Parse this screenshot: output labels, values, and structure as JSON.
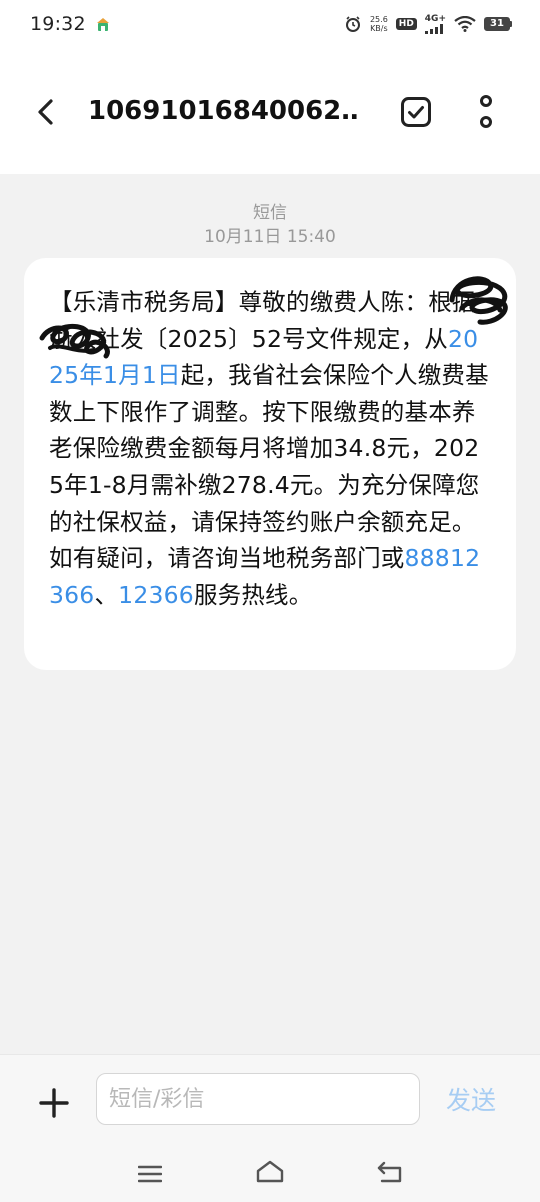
{
  "status_bar": {
    "time": "19:32",
    "net_speed_value": "25.6",
    "net_speed_unit": "KB/s",
    "hd": "HD",
    "network": "4G+",
    "battery": "31"
  },
  "header": {
    "title": "10691016840062…"
  },
  "thread": {
    "message_type": "短信",
    "timestamp": "10月11日 15:40",
    "message": {
      "part1": "【乐清市税务局】尊敬的缴费人陈",
      "part2": "：根据浙人社发〔2025〕52号文件规定，从",
      "link_date": "2025年1月1日",
      "part3": "起，我省社会保险个人缴费基数上下限作了调整。按下限缴费的基本养老保险缴费金额每月将增加34.8元，2025年1-8月需补缴278.4元。为充分保障您的社保权益，请保持签约账户余额充足。如有疑问，请咨询当地税务部门或",
      "link_phone1": "88812366",
      "separator": "、",
      "link_phone2": "12366",
      "part4": "服务热线。"
    }
  },
  "input_bar": {
    "placeholder": "短信/彩信",
    "send_label": "发送"
  },
  "icons": {
    "back": "chevron-left-icon",
    "select": "checkbox-square-icon",
    "more": "more-vertical-icon",
    "add": "plus-icon",
    "nav_menu": "menu-icon",
    "nav_home": "home-icon",
    "nav_back": "back-icon"
  },
  "colors": {
    "link": "#3a8ee6",
    "send_disabled": "#a7cdf3",
    "background": "#f2f2f2",
    "bubble": "#ffffff"
  }
}
